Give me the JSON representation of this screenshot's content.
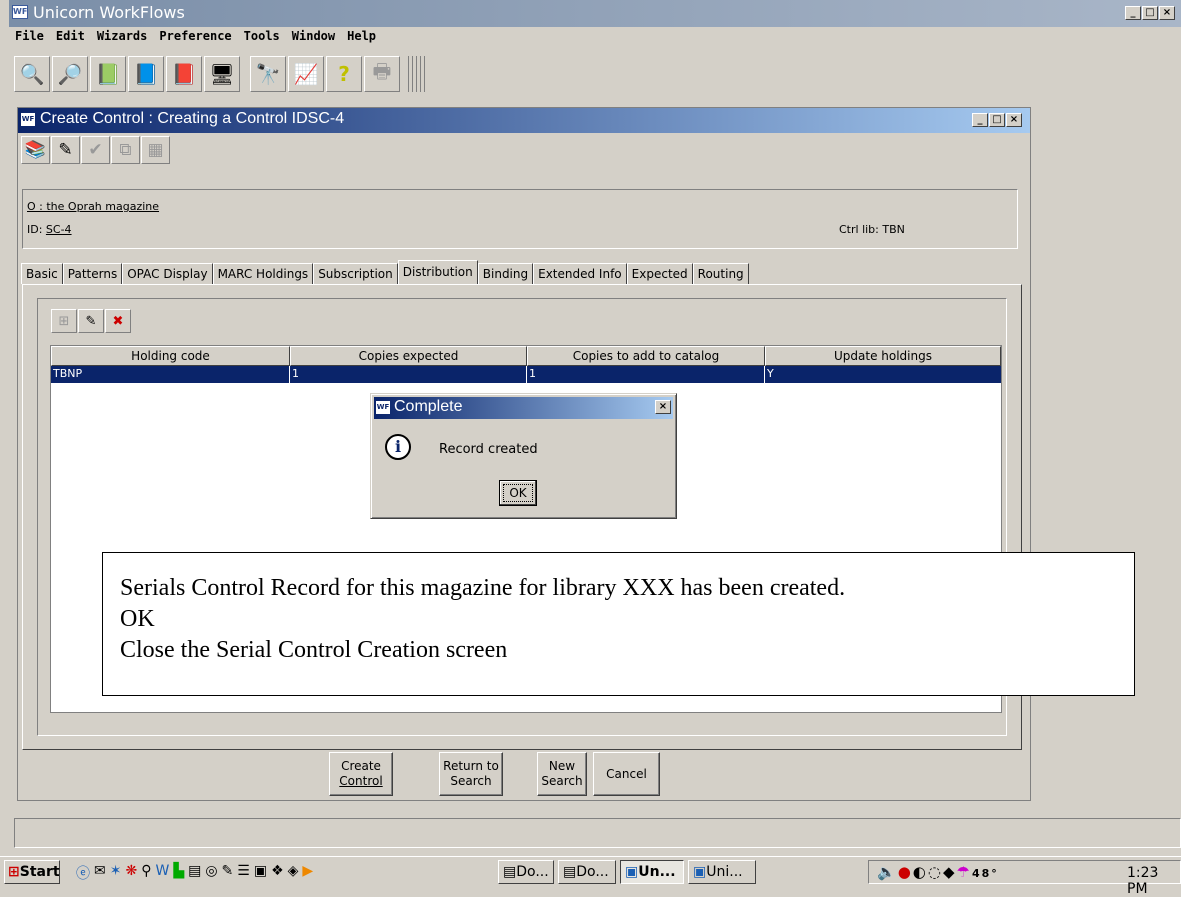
{
  "app": {
    "title": "Unicorn WorkFlows",
    "icon": "WF",
    "menus": [
      "File",
      "Edit",
      "Wizards",
      "Preference",
      "Tools",
      "Window",
      "Help"
    ]
  },
  "child": {
    "title": "Create Control : Creating a Control IDSC-4",
    "record_title": "O : the Oprah magazine",
    "id_label": "ID: ",
    "id_value": "SC-4",
    "ctrl_lib": "Ctrl lib: TBN",
    "tabs": [
      "Basic",
      "Patterns",
      "OPAC Display",
      "MARC Holdings",
      "Subscription",
      "Distribution",
      "Binding",
      "Extended Info",
      "Expected",
      "Routing"
    ],
    "active_tab": "Distribution",
    "grid": {
      "columns": [
        "Holding code",
        "Copies expected",
        "Copies to add to catalog",
        "Update holdings"
      ],
      "rows": [
        [
          "TBNP",
          "1",
          "1",
          "Y"
        ]
      ]
    },
    "buttons": {
      "create_line1": "Create",
      "create_line2": "Control",
      "return_line1": "Return to",
      "return_line2": "Search",
      "new_line1": "New",
      "new_line2": "Search",
      "cancel": "Cancel"
    }
  },
  "dialog": {
    "title": "Complete",
    "message": "Record created",
    "ok": "OK"
  },
  "annotation": {
    "line1": "Serials Control Record for this magazine for library XXX has been created.",
    "line2": "OK",
    "line3": "Close the Serial Control Creation screen"
  },
  "taskbar": {
    "start": "Start",
    "tasks": [
      "Do...",
      "Do...",
      "Un...",
      "Uni..."
    ],
    "tray_temp": "48°",
    "clock": "1:23 PM"
  }
}
